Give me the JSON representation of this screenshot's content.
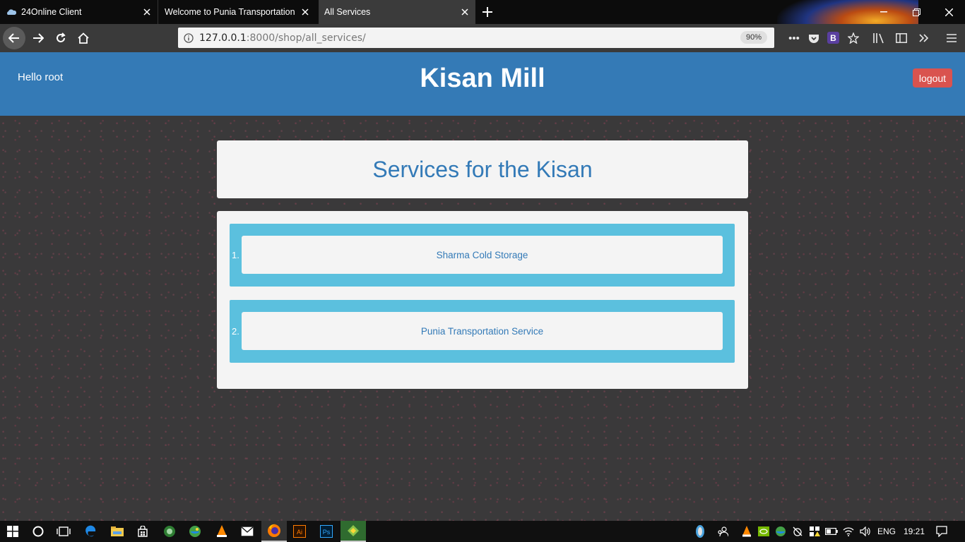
{
  "browser": {
    "tabs": [
      {
        "title": "24Online Client"
      },
      {
        "title": "Welcome to Punia Transportation S"
      },
      {
        "title": "All Services"
      }
    ],
    "url_host": "127.0.0.1",
    "url_path": ":8000/shop/all_services/",
    "zoom": "90%",
    "bootstrap_ext": "B"
  },
  "header": {
    "greeting": "Hello root",
    "brand": "Kisan Mill",
    "logout_label": "logout"
  },
  "main": {
    "title": "Services for the Kisan",
    "services": [
      {
        "number": "1.",
        "name": "Sharma Cold Storage"
      },
      {
        "number": "2.",
        "name": "Punia Transportation Service"
      }
    ]
  },
  "taskbar": {
    "language": "ENG",
    "time": "19:21",
    "ai_label": "Ai",
    "ps_label": "Ps"
  },
  "colors": {
    "header": "#347ab6",
    "logout": "#d9534f",
    "service_bg": "#5bc0de",
    "link": "#337ab7"
  }
}
